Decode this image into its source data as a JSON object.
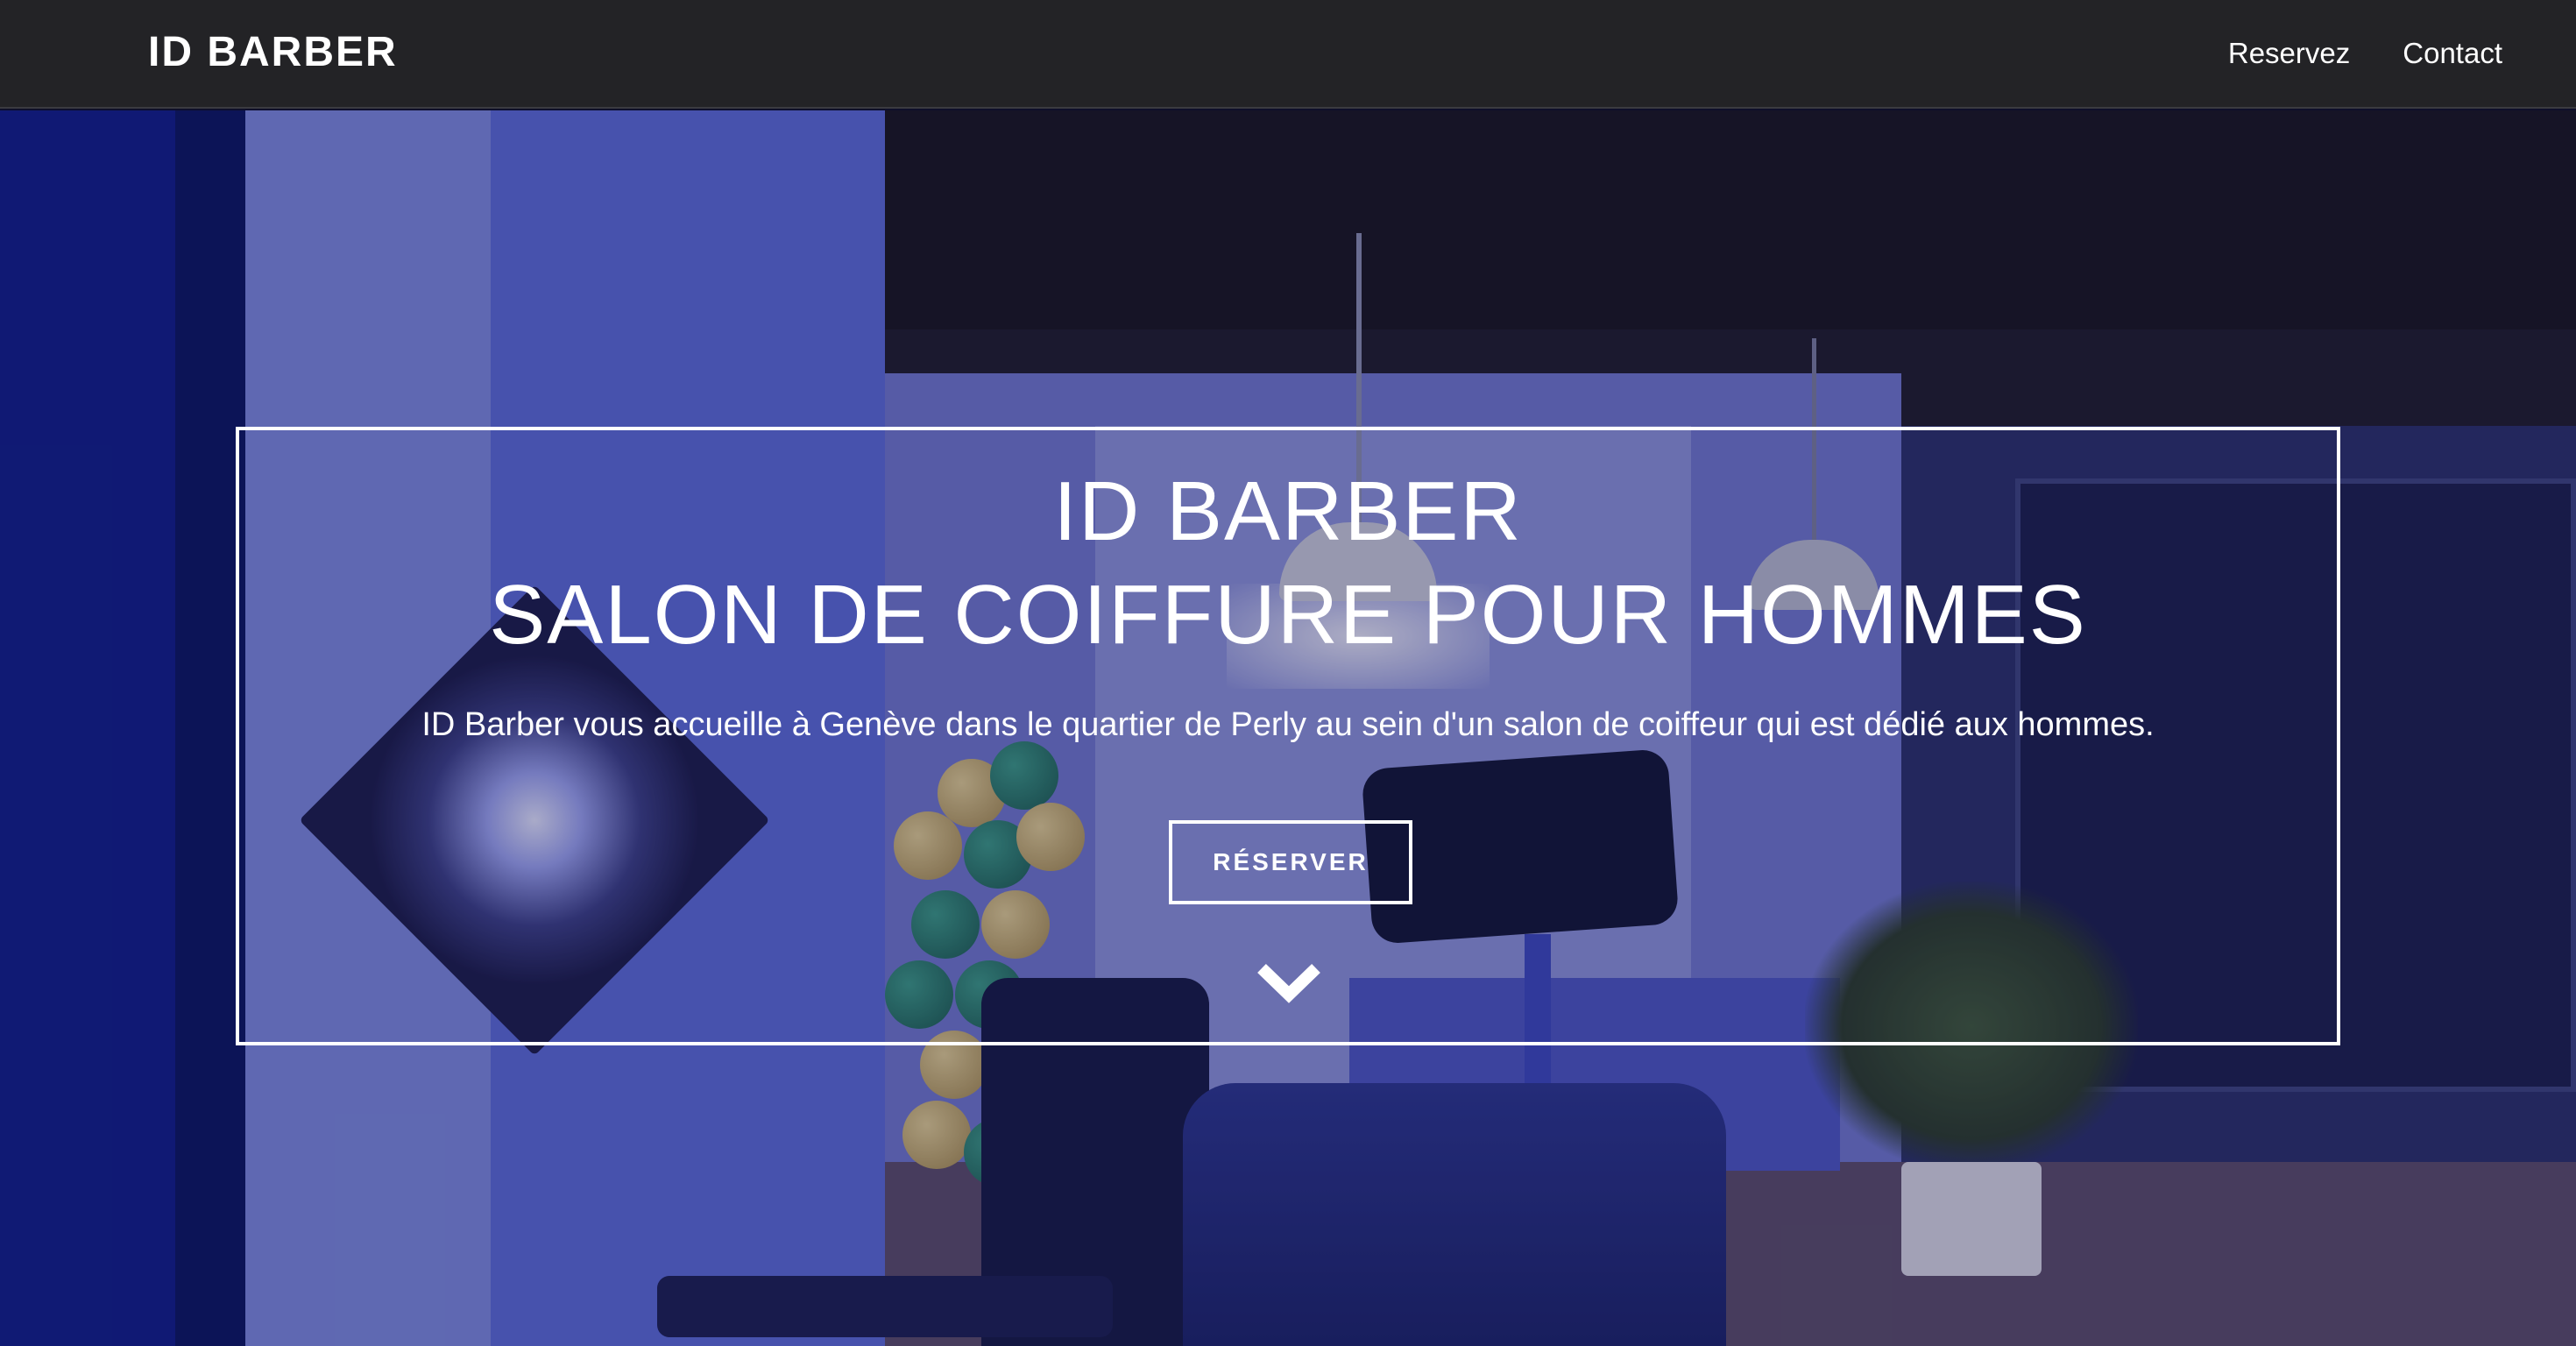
{
  "navbar": {
    "brand": "ID BARBER",
    "links": [
      {
        "label": "Reservez"
      },
      {
        "label": "Contact"
      }
    ]
  },
  "hero": {
    "title_line1": "ID BARBER",
    "title_line2": "SALON DE COIFFURE POUR HOMMES",
    "description": "ID Barber vous accueille à Genève dans le quartier de Perly au sein d'un salon de coiffeur qui est dédié aux hommes.",
    "cta_label": "RÉSERVER",
    "scroll_icon": "chevron-down-icon"
  },
  "colors": {
    "navbar_bg": "#232326",
    "text": "#ffffff",
    "hero_tint": "#2a2f7a"
  }
}
